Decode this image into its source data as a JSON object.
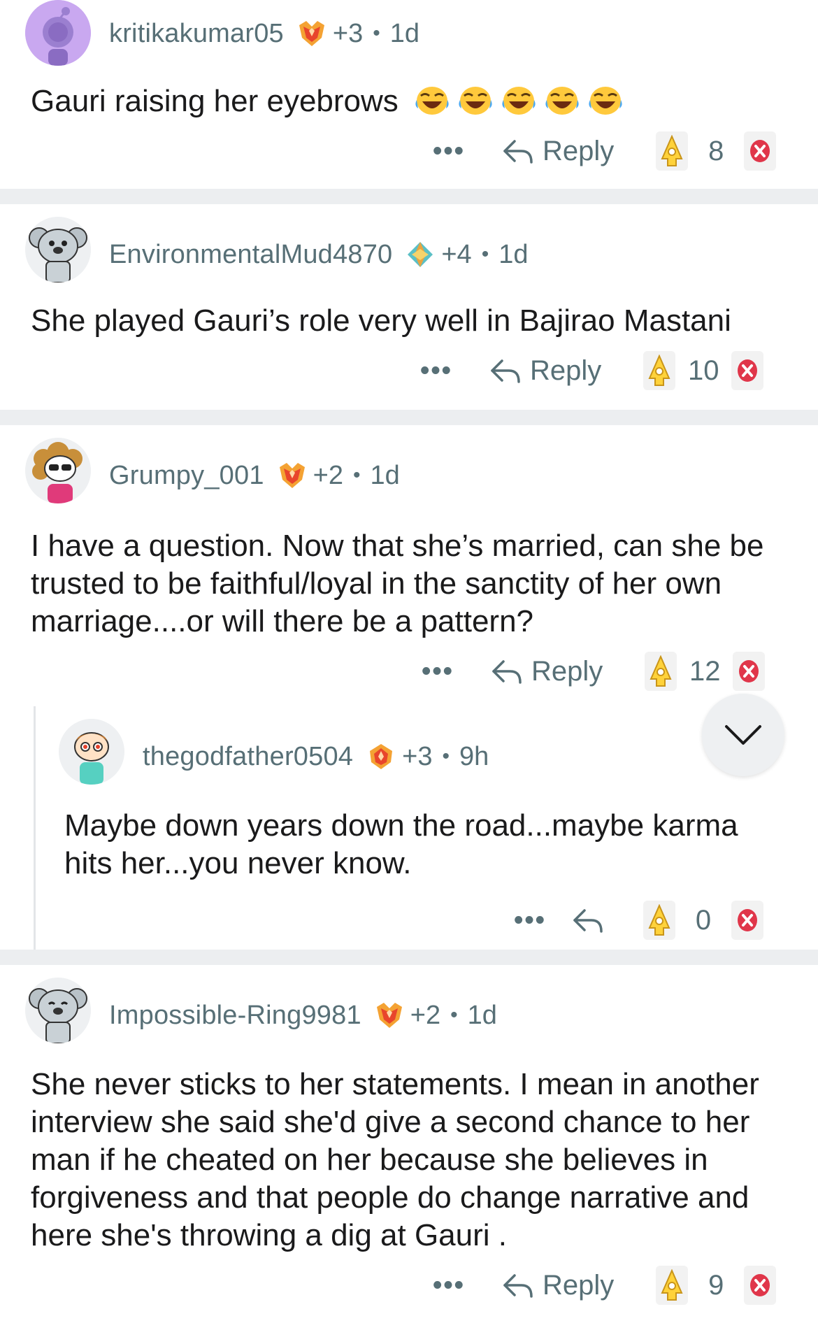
{
  "comments": [
    {
      "username": "kritikakumar05",
      "karma": "+3",
      "dot": "•",
      "age": "1d",
      "text": "Gauri raising her eyebrows",
      "emojis": [
        "joy",
        "joy",
        "joy",
        "joy",
        "joy"
      ],
      "more": "•••",
      "reply_label": "Reply",
      "score": "8"
    },
    {
      "username": "EnvironmentalMud4870",
      "karma": "+4",
      "dot": "•",
      "age": "1d",
      "text": "She played Gauri’s role very well in Bajirao Mastani",
      "more": "•••",
      "reply_label": "Reply",
      "score": "10"
    },
    {
      "username": "Grumpy_001",
      "karma": "+2",
      "dot": "•",
      "age": "1d",
      "text": "I have a question. Now that she’s married, can she be trusted to be faithful/loyal in the sanctity of her own marriage....or will there be a pattern?",
      "more": "•••",
      "reply_label": "Reply",
      "score": "12"
    },
    {
      "username": "thegodfather0504",
      "karma": "+3",
      "dot": "•",
      "age": "9h",
      "text": "Maybe down years down the road...maybe karma hits her...you never know.",
      "more": "•••",
      "reply_label": "",
      "score": "0"
    },
    {
      "username": "Impossible-Ring9981",
      "karma": "+2",
      "dot": "•",
      "age": "1d",
      "text": "She never sticks to her statements. I mean in another interview she said she'd give a second chance to her man if he cheated on her because she believes in forgiveness and that people do change narrative and here she's throwing a dig at Gauri .",
      "more": "•••",
      "reply_label": "Reply",
      "score": "9"
    }
  ],
  "colors": {
    "meta_gray": "#576f76",
    "divider": "#eceef0",
    "award_orange": "#e8452c",
    "downvote_red": "#e0364a"
  },
  "icons": {
    "award": "crystal-award-icon",
    "reply": "reply-arrow-icon",
    "upvote": "upvote-award-icon",
    "downvote": "downvote-x-icon",
    "scroll": "chevron-down-icon"
  }
}
